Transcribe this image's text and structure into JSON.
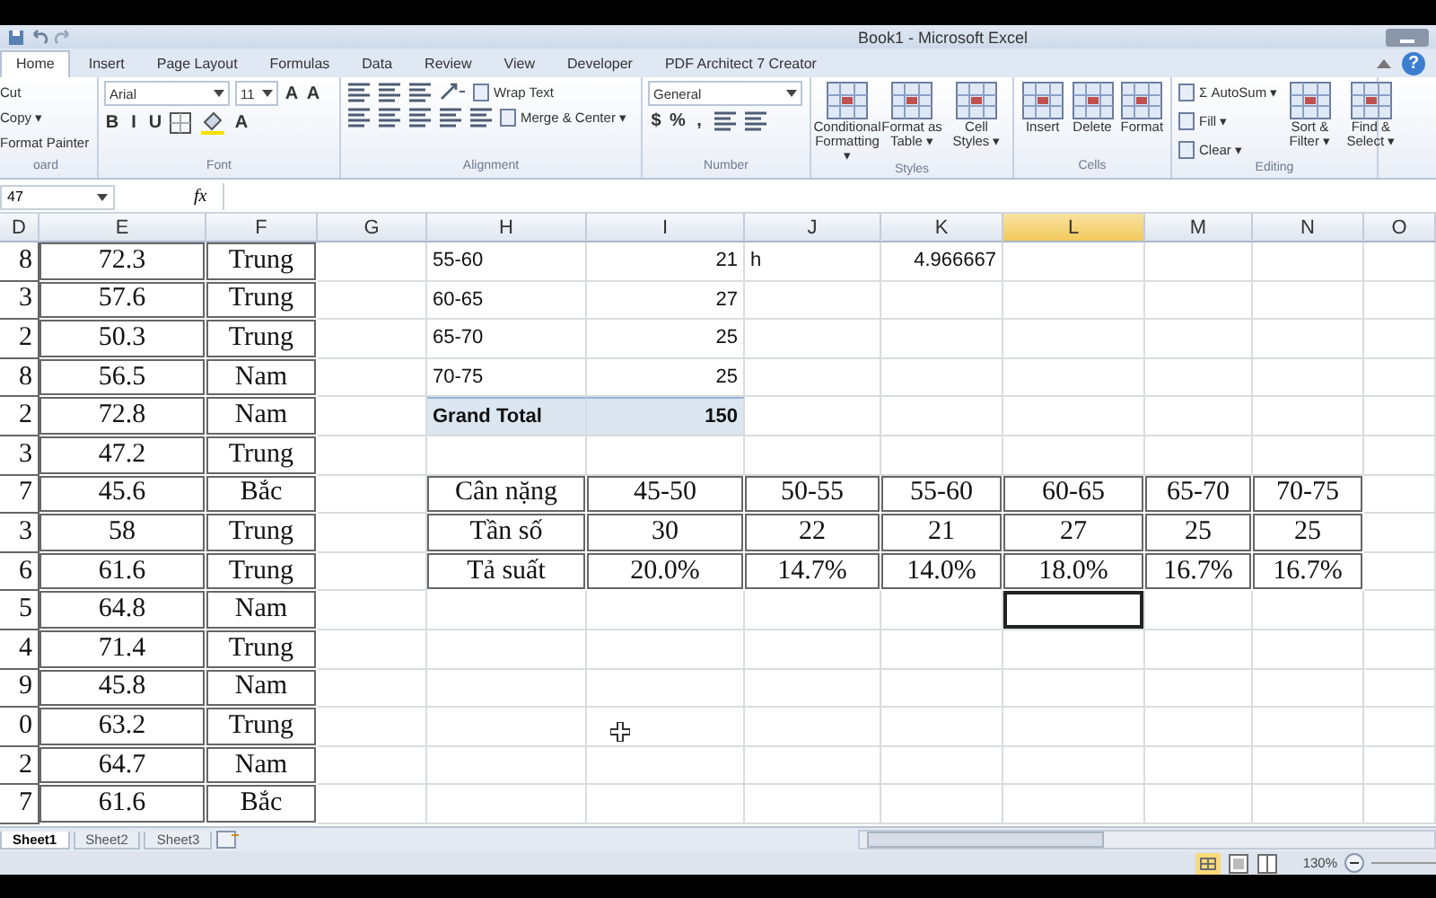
{
  "window": {
    "title": "Book1 - Microsoft Excel"
  },
  "tabs": [
    {
      "label": "Home",
      "selected": true
    },
    {
      "label": "Insert",
      "selected": false
    },
    {
      "label": "Page Layout",
      "selected": false
    },
    {
      "label": "Formulas",
      "selected": false
    },
    {
      "label": "Data",
      "selected": false
    },
    {
      "label": "Review",
      "selected": false
    },
    {
      "label": "View",
      "selected": false
    },
    {
      "label": "Developer",
      "selected": false
    },
    {
      "label": "PDF Architect 7 Creator",
      "selected": false
    }
  ],
  "help": "?",
  "ribbon": [
    {
      "label": "oard",
      "kind": "stack",
      "items": [
        {
          "kind": "small",
          "label": "Cut"
        },
        {
          "kind": "small",
          "label": "Copy ▾"
        },
        {
          "kind": "small",
          "label": "Format Painter"
        }
      ]
    },
    {
      "label": "Font",
      "kind": "lines",
      "top": [
        {
          "kind": "field",
          "value": "Arial",
          "wide": true
        },
        {
          "kind": "field",
          "value": "11",
          "wide": false
        },
        {
          "kind": "glyph",
          "label": "A"
        },
        {
          "kind": "glyph",
          "label": "A"
        }
      ],
      "bottom": [
        {
          "kind": "glyph",
          "label": "B"
        },
        {
          "kind": "glyph",
          "label": "I"
        },
        {
          "kind": "glyph",
          "label": "U"
        },
        {
          "kind": "borders"
        },
        {
          "kind": "fill"
        },
        {
          "kind": "glyph",
          "label": "A"
        }
      ]
    },
    {
      "label": "Alignment",
      "kind": "lines",
      "top": [
        {
          "kind": "lines"
        },
        {
          "kind": "lines"
        },
        {
          "kind": "lines"
        },
        {
          "kind": "orient"
        },
        {
          "kind": "small",
          "label": "Wrap Text"
        }
      ],
      "bottom": [
        {
          "kind": "lines"
        },
        {
          "kind": "lines"
        },
        {
          "kind": "lines"
        },
        {
          "kind": "lines"
        },
        {
          "kind": "lines"
        },
        {
          "kind": "small",
          "label": "Merge & Center ▾"
        }
      ]
    },
    {
      "label": "Number",
      "kind": "lines",
      "top": [
        {
          "kind": "field",
          "value": "General",
          "wide": true
        }
      ],
      "bottom": [
        {
          "kind": "glyph",
          "label": "$"
        },
        {
          "kind": "glyph",
          "label": "%"
        },
        {
          "kind": "glyph",
          "label": ","
        },
        {
          "kind": "lines"
        },
        {
          "kind": "lines"
        }
      ]
    },
    {
      "label": "Styles",
      "kind": "row",
      "items": [
        {
          "kind": "large",
          "label": "Conditional Formatting ▾"
        },
        {
          "kind": "large",
          "label": "Format as Table ▾"
        },
        {
          "kind": "large",
          "label": "Cell Styles ▾"
        }
      ]
    },
    {
      "label": "Cells",
      "kind": "row",
      "items": [
        {
          "kind": "large",
          "label": "Insert"
        },
        {
          "kind": "large",
          "label": "Delete"
        },
        {
          "kind": "large",
          "label": "Format"
        }
      ]
    },
    {
      "label": "Editing",
      "kind": "editing",
      "items": [
        {
          "kind": "small",
          "label": "Σ AutoSum ▾"
        },
        {
          "kind": "small",
          "label": "Fill ▾"
        },
        {
          "kind": "small",
          "label": "Clear ▾"
        },
        {
          "kind": "large",
          "label": "Sort & Filter ▾"
        },
        {
          "kind": "large",
          "label": "Find & Select ▾"
        }
      ]
    }
  ],
  "formula_bar": {
    "name_box": "47",
    "fx": "fx"
  },
  "grid": {
    "columns": [
      {
        "label": "D",
        "selected": false
      },
      {
        "label": "E",
        "selected": false
      },
      {
        "label": "F",
        "selected": false
      },
      {
        "label": "G",
        "selected": false
      },
      {
        "label": "H",
        "selected": false
      },
      {
        "label": "I",
        "selected": false
      },
      {
        "label": "J",
        "selected": false
      },
      {
        "label": "K",
        "selected": false
      },
      {
        "label": "L",
        "selected": true
      },
      {
        "label": "M",
        "selected": false
      },
      {
        "label": "N",
        "selected": false
      },
      {
        "label": "O",
        "selected": false
      }
    ],
    "rows": [
      {
        "cells": [
          {
            "kind": "cut",
            "text": "8"
          },
          {
            "kind": "data",
            "text": "72.3"
          },
          {
            "kind": "data",
            "text": "Trung"
          },
          null,
          {
            "kind": "text",
            "text": "55-60"
          },
          {
            "kind": "num",
            "text": "21"
          },
          {
            "kind": "text",
            "text": "h"
          },
          {
            "kind": "num",
            "text": "4.966667"
          },
          null,
          null,
          null,
          null
        ]
      },
      {
        "cells": [
          {
            "kind": "cut",
            "text": "3"
          },
          {
            "kind": "data",
            "text": "57.6"
          },
          {
            "kind": "data",
            "text": "Trung"
          },
          null,
          {
            "kind": "text",
            "text": "60-65"
          },
          {
            "kind": "num",
            "text": "27"
          },
          null,
          null,
          null,
          null,
          null,
          null
        ]
      },
      {
        "cells": [
          {
            "kind": "cut",
            "text": "2"
          },
          {
            "kind": "data",
            "text": "50.3"
          },
          {
            "kind": "data",
            "text": "Trung"
          },
          null,
          {
            "kind": "text",
            "text": "65-70"
          },
          {
            "kind": "num",
            "text": "25"
          },
          null,
          null,
          null,
          null,
          null,
          null
        ]
      },
      {
        "cells": [
          {
            "kind": "cut",
            "text": "8"
          },
          {
            "kind": "data",
            "text": "56.5"
          },
          {
            "kind": "data",
            "text": "Nam"
          },
          null,
          {
            "kind": "text",
            "text": "70-75"
          },
          {
            "kind": "num",
            "text": "25"
          },
          null,
          null,
          null,
          null,
          null,
          null
        ]
      },
      {
        "cells": [
          {
            "kind": "cut",
            "text": "2"
          },
          {
            "kind": "data",
            "text": "72.8"
          },
          {
            "kind": "data",
            "text": "Nam"
          },
          null,
          {
            "kind": "total",
            "text": "Grand Total"
          },
          {
            "kind": "totalnum",
            "text": "150"
          },
          null,
          null,
          null,
          null,
          null,
          null
        ]
      },
      {
        "cells": [
          {
            "kind": "cut",
            "text": "3"
          },
          {
            "kind": "data",
            "text": "47.2"
          },
          {
            "kind": "data",
            "text": "Trung"
          },
          null,
          null,
          null,
          null,
          null,
          null,
          null,
          null,
          null
        ]
      },
      {
        "cells": [
          {
            "kind": "cut",
            "text": "7"
          },
          {
            "kind": "data",
            "text": "45.6"
          },
          {
            "kind": "data",
            "text": "Bắc"
          },
          null,
          {
            "kind": "data",
            "text": "Cân nặng"
          },
          {
            "kind": "data",
            "text": "45-50"
          },
          {
            "kind": "data",
            "text": "50-55"
          },
          {
            "kind": "data",
            "text": "55-60"
          },
          {
            "kind": "data",
            "text": "60-65"
          },
          {
            "kind": "data",
            "text": "65-70"
          },
          {
            "kind": "data",
            "text": "70-75"
          },
          null
        ]
      },
      {
        "cells": [
          {
            "kind": "cut",
            "text": "3"
          },
          {
            "kind": "data",
            "text": "58"
          },
          {
            "kind": "data",
            "text": "Trung"
          },
          null,
          {
            "kind": "data",
            "text": "Tần số"
          },
          {
            "kind": "data",
            "text": "30"
          },
          {
            "kind": "data",
            "text": "22"
          },
          {
            "kind": "data",
            "text": "21"
          },
          {
            "kind": "data",
            "text": "27"
          },
          {
            "kind": "data",
            "text": "25"
          },
          {
            "kind": "data",
            "text": "25"
          },
          null
        ]
      },
      {
        "cells": [
          {
            "kind": "cut",
            "text": "6"
          },
          {
            "kind": "data",
            "text": "61.6"
          },
          {
            "kind": "data",
            "text": "Trung"
          },
          null,
          {
            "kind": "data",
            "text": "Tả suất"
          },
          {
            "kind": "data",
            "text": "20.0%"
          },
          {
            "kind": "data",
            "text": "14.7%"
          },
          {
            "kind": "data",
            "text": "14.0%"
          },
          {
            "kind": "data",
            "text": "18.0%"
          },
          {
            "kind": "data",
            "text": "16.7%"
          },
          {
            "kind": "data",
            "text": "16.7%"
          },
          null
        ]
      },
      {
        "cells": [
          {
            "kind": "cut",
            "text": "5"
          },
          {
            "kind": "data",
            "text": "64.8"
          },
          {
            "kind": "data",
            "text": "Nam"
          },
          null,
          null,
          null,
          null,
          null,
          {
            "kind": "active"
          },
          null,
          null,
          null
        ]
      },
      {
        "cells": [
          {
            "kind": "cut",
            "text": "4"
          },
          {
            "kind": "data",
            "text": "71.4"
          },
          {
            "kind": "data",
            "text": "Trung"
          },
          null,
          null,
          null,
          null,
          null,
          null,
          null,
          null,
          null
        ]
      },
      {
        "cells": [
          {
            "kind": "cut",
            "text": "9"
          },
          {
            "kind": "data",
            "text": "45.8"
          },
          {
            "kind": "data",
            "text": "Nam"
          },
          null,
          null,
          null,
          null,
          null,
          null,
          null,
          null,
          null
        ]
      },
      {
        "cells": [
          {
            "kind": "cut",
            "text": "0"
          },
          {
            "kind": "data",
            "text": "63.2"
          },
          {
            "kind": "data",
            "text": "Trung"
          },
          null,
          null,
          null,
          null,
          null,
          null,
          null,
          null,
          null
        ]
      },
      {
        "cells": [
          {
            "kind": "cut",
            "text": "2"
          },
          {
            "kind": "data",
            "text": "64.7"
          },
          {
            "kind": "data",
            "text": "Nam"
          },
          null,
          null,
          null,
          null,
          null,
          null,
          null,
          null,
          null
        ]
      },
      {
        "cells": [
          {
            "kind": "cut",
            "text": "7"
          },
          {
            "kind": "data",
            "text": "61.6"
          },
          {
            "kind": "data",
            "text": "Bắc"
          },
          null,
          null,
          null,
          null,
          null,
          null,
          null,
          null,
          null
        ]
      }
    ]
  },
  "sheet_tabs": [
    {
      "label": "Sheet1",
      "selected": true
    },
    {
      "label": "Sheet2",
      "selected": false
    },
    {
      "label": "Sheet3",
      "selected": false
    }
  ],
  "status_bar": {
    "zoom": "130%"
  }
}
